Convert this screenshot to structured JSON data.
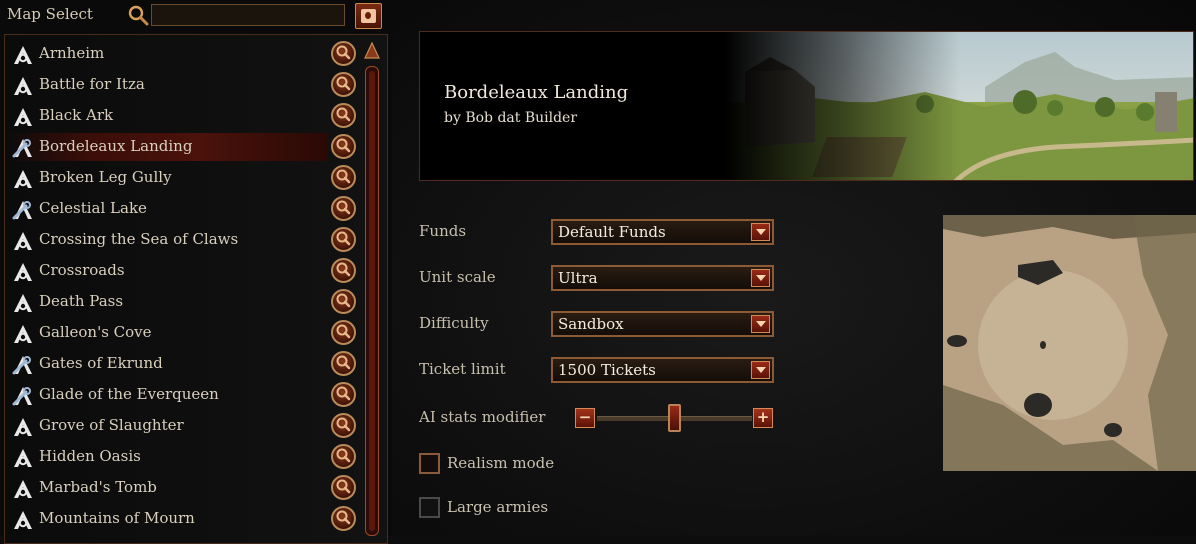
{
  "header": {
    "title": "Map Select",
    "search": {
      "value": "",
      "placeholder": ""
    }
  },
  "map_list": {
    "selected": "Bordeleaux Landing",
    "items": [
      {
        "label": "Arnheim",
        "icon": "official-map-icon"
      },
      {
        "label": "Battle for Itza",
        "icon": "official-map-icon"
      },
      {
        "label": "Black Ark",
        "icon": "official-map-icon"
      },
      {
        "label": "Bordeleaux Landing",
        "icon": "custom-map-icon"
      },
      {
        "label": "Broken Leg Gully",
        "icon": "official-map-icon"
      },
      {
        "label": "Celestial Lake",
        "icon": "custom-map-icon"
      },
      {
        "label": "Crossing the Sea of Claws",
        "icon": "official-map-icon"
      },
      {
        "label": "Crossroads",
        "icon": "official-map-icon"
      },
      {
        "label": "Death Pass",
        "icon": "official-map-icon"
      },
      {
        "label": "Galleon's Cove",
        "icon": "official-map-icon"
      },
      {
        "label": "Gates of Ekrund",
        "icon": "custom-map-icon"
      },
      {
        "label": "Glade of the Everqueen",
        "icon": "custom-map-icon"
      },
      {
        "label": "Grove of Slaughter",
        "icon": "official-map-icon"
      },
      {
        "label": "Hidden Oasis",
        "icon": "official-map-icon"
      },
      {
        "label": "Marbad's Tomb",
        "icon": "official-map-icon"
      },
      {
        "label": "Mountains of Mourn",
        "icon": "official-map-icon"
      }
    ]
  },
  "banner": {
    "title": "Bordeleaux Landing",
    "author": "by Bob dat Builder"
  },
  "options": {
    "funds": {
      "label": "Funds",
      "value": "Default Funds"
    },
    "unit_scale": {
      "label": "Unit scale",
      "value": "Ultra"
    },
    "difficulty": {
      "label": "Difficulty",
      "value": "Sandbox"
    },
    "ticket_limit": {
      "label": "Ticket limit",
      "value": "1500 Tickets"
    },
    "ai_stats": {
      "label": "AI stats modifier",
      "minus": "−",
      "plus": "+",
      "level": 0.5
    },
    "realism_mode": {
      "label": "Realism mode",
      "checked": false
    },
    "large_armies": {
      "label": "Large armies",
      "checked": false
    }
  },
  "colors": {
    "accent_red": "#8a2a14",
    "border_gold": "#b98a5a",
    "text_light": "#d9cfbd"
  }
}
